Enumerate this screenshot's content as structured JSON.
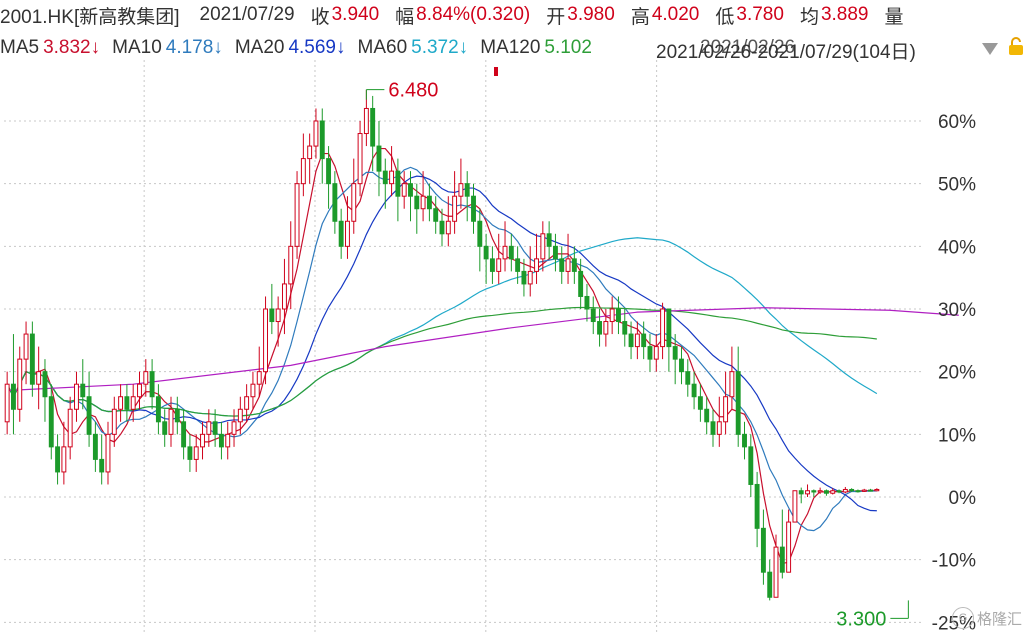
{
  "header": {
    "stock_code": "2001.HK[新高教集团]",
    "date": "2021/07/29",
    "close_label": "收",
    "close": "3.940",
    "change_label": "幅",
    "change": "8.84%(0.320)",
    "open_label": "开",
    "open": "3.980",
    "high_label": "高",
    "high": "4.020",
    "low_label": "低",
    "low": "3.780",
    "avg_label": "均",
    "avg": "3.889",
    "volume_label": "量"
  },
  "ma_row": {
    "ma5_label": "MA5",
    "ma5": "3.832↓",
    "ma10_label": "MA10",
    "ma10": "4.178↓",
    "ma20_label": "MA20",
    "ma20": "4.569↓",
    "ma60_label": "MA60",
    "ma60": "5.372↓",
    "ma120_label": "MA120",
    "ma120": "5.102",
    "overlap_text": "2021/02/26-2021/07/29(104日)",
    "overlap_date": "2021/02/26"
  },
  "toolbar": {
    "dropdown_icon": "triangle-down-icon",
    "lock_icon": "lock-icon"
  },
  "watermark": {
    "text": "格隆汇",
    "logo": "G"
  },
  "colors": {
    "up": "#d0021b",
    "down": "#1c9a2a",
    "ma5": "#c8102e",
    "ma10": "#2f7bbd",
    "ma20": "#1739c4",
    "ma60": "#1fa9c9",
    "ma120": "#2e9e38",
    "ma250": "#b01fc2",
    "grid": "#c8c8c8"
  },
  "chart_data": {
    "type": "candlestick",
    "y_axis": {
      "unit": "percent change from start",
      "min": -25,
      "max": 65,
      "ticks": [
        60,
        50,
        40,
        30,
        20,
        10,
        0,
        -10,
        -20
      ],
      "tick_labels": [
        "60%",
        "50%",
        "40%",
        "30%",
        "20%",
        "10%",
        "0%",
        "-10%",
        "-25%"
      ]
    },
    "annotations": [
      {
        "label": "6.480",
        "type": "max",
        "bar_index": 57,
        "value": 65.0
      },
      {
        "label": "3.300",
        "type": "min",
        "bar_index": 143,
        "value": -16.5
      }
    ],
    "candles": [
      [
        12,
        18,
        20,
        10
      ],
      [
        18,
        14,
        26,
        10
      ],
      [
        14,
        22,
        24,
        12
      ],
      [
        22,
        26,
        28,
        18
      ],
      [
        26,
        18,
        28,
        16
      ],
      [
        18,
        20,
        24,
        14
      ],
      [
        20,
        16,
        22,
        12
      ],
      [
        16,
        8,
        18,
        6
      ],
      [
        8,
        4,
        10,
        2
      ],
      [
        4,
        8,
        12,
        2
      ],
      [
        8,
        14,
        16,
        6
      ],
      [
        14,
        18,
        20,
        12
      ],
      [
        18,
        16,
        22,
        14
      ],
      [
        16,
        10,
        20,
        8
      ],
      [
        10,
        6,
        12,
        4
      ],
      [
        6,
        4,
        10,
        2
      ],
      [
        4,
        10,
        12,
        2
      ],
      [
        10,
        14,
        16,
        8
      ],
      [
        14,
        16,
        18,
        12
      ],
      [
        16,
        14,
        18,
        12
      ],
      [
        14,
        16,
        18,
        12
      ],
      [
        16,
        18,
        20,
        14
      ],
      [
        18,
        20,
        22,
        16
      ],
      [
        20,
        16,
        22,
        14
      ],
      [
        16,
        12,
        18,
        10
      ],
      [
        12,
        10,
        14,
        8
      ],
      [
        10,
        14,
        16,
        8
      ],
      [
        14,
        12,
        16,
        10
      ],
      [
        12,
        8,
        14,
        6
      ],
      [
        8,
        6,
        10,
        4
      ],
      [
        6,
        8,
        10,
        4
      ],
      [
        8,
        10,
        12,
        6
      ],
      [
        10,
        12,
        14,
        8
      ],
      [
        12,
        10,
        14,
        8
      ],
      [
        10,
        8,
        12,
        6
      ],
      [
        8,
        10,
        12,
        6
      ],
      [
        10,
        12,
        14,
        8
      ],
      [
        12,
        14,
        16,
        10
      ],
      [
        14,
        16,
        18,
        12
      ],
      [
        16,
        18,
        20,
        14
      ],
      [
        18,
        20,
        24,
        16
      ],
      [
        20,
        30,
        32,
        18
      ],
      [
        30,
        28,
        34,
        26
      ],
      [
        28,
        30,
        32,
        24
      ],
      [
        30,
        34,
        38,
        26
      ],
      [
        34,
        40,
        44,
        30
      ],
      [
        40,
        50,
        52,
        38
      ],
      [
        50,
        54,
        58,
        48
      ],
      [
        54,
        56,
        58,
        50
      ],
      [
        56,
        60,
        62,
        54
      ],
      [
        60,
        54,
        62,
        50
      ],
      [
        54,
        50,
        56,
        46
      ],
      [
        50,
        44,
        52,
        42
      ],
      [
        44,
        40,
        46,
        38
      ],
      [
        40,
        44,
        48,
        38
      ],
      [
        44,
        50,
        54,
        42
      ],
      [
        50,
        58,
        60,
        48
      ],
      [
        58,
        62,
        65,
        56
      ],
      [
        62,
        56,
        64,
        52
      ],
      [
        56,
        52,
        60,
        48
      ],
      [
        52,
        50,
        54,
        46
      ],
      [
        50,
        52,
        56,
        48
      ],
      [
        52,
        48,
        54,
        44
      ],
      [
        48,
        50,
        52,
        46
      ],
      [
        50,
        48,
        52,
        44
      ],
      [
        48,
        46,
        50,
        42
      ],
      [
        46,
        48,
        52,
        44
      ],
      [
        48,
        46,
        50,
        44
      ],
      [
        46,
        44,
        48,
        42
      ],
      [
        44,
        42,
        46,
        40
      ],
      [
        42,
        44,
        48,
        40
      ],
      [
        44,
        48,
        52,
        42
      ],
      [
        48,
        50,
        54,
        46
      ],
      [
        50,
        48,
        52,
        44
      ],
      [
        48,
        44,
        50,
        42
      ],
      [
        44,
        40,
        46,
        36
      ],
      [
        40,
        38,
        42,
        34
      ],
      [
        38,
        36,
        40,
        34
      ],
      [
        36,
        38,
        42,
        34
      ],
      [
        38,
        40,
        44,
        36
      ],
      [
        40,
        38,
        42,
        36
      ],
      [
        38,
        36,
        40,
        34
      ],
      [
        36,
        34,
        38,
        32
      ],
      [
        34,
        36,
        40,
        32
      ],
      [
        36,
        38,
        42,
        34
      ],
      [
        38,
        42,
        44,
        36
      ],
      [
        42,
        40,
        44,
        38
      ],
      [
        40,
        38,
        42,
        36
      ],
      [
        38,
        36,
        40,
        34
      ],
      [
        36,
        38,
        42,
        34
      ],
      [
        38,
        36,
        40,
        34
      ],
      [
        36,
        32,
        38,
        30
      ],
      [
        32,
        30,
        34,
        28
      ],
      [
        30,
        28,
        32,
        26
      ],
      [
        28,
        26,
        30,
        24
      ],
      [
        26,
        28,
        30,
        24
      ],
      [
        28,
        30,
        32,
        26
      ],
      [
        30,
        28,
        32,
        26
      ],
      [
        28,
        26,
        30,
        24
      ],
      [
        26,
        24,
        28,
        22
      ],
      [
        24,
        26,
        28,
        22
      ],
      [
        26,
        24,
        28,
        22
      ],
      [
        24,
        22,
        26,
        20
      ],
      [
        22,
        24,
        26,
        20
      ],
      [
        24,
        30,
        31,
        22
      ],
      [
        30,
        24,
        30,
        20
      ],
      [
        24,
        22,
        26,
        18
      ],
      [
        22,
        20,
        24,
        18
      ],
      [
        20,
        18,
        22,
        16
      ],
      [
        18,
        16,
        20,
        14
      ],
      [
        16,
        14,
        18,
        12
      ],
      [
        14,
        12,
        16,
        10
      ],
      [
        12,
        10,
        14,
        8
      ],
      [
        10,
        12,
        16,
        8
      ],
      [
        12,
        16,
        20,
        10
      ],
      [
        16,
        20,
        24,
        14
      ],
      [
        20,
        10,
        24,
        8
      ],
      [
        10,
        8,
        12,
        6
      ],
      [
        8,
        2,
        10,
        0
      ],
      [
        2,
        -5,
        4,
        -8
      ],
      [
        -5,
        -12,
        -2,
        -14
      ],
      [
        -12,
        -16,
        -10,
        -16.5
      ],
      [
        -16,
        -8,
        -6,
        -16
      ],
      [
        -8,
        -12,
        -2,
        -13
      ],
      [
        -12,
        -4,
        -2,
        -12
      ],
      [
        -4,
        1,
        1,
        -3
      ],
      [
        1,
        0.5,
        1.5,
        -1
      ],
      [
        0.5,
        1,
        2,
        0
      ],
      [
        1,
        0.8,
        1.2,
        0
      ],
      [
        0.8,
        1,
        1.5,
        0.5
      ],
      [
        1,
        0.6,
        1.2,
        0.2
      ],
      [
        0.6,
        1,
        1.4,
        0.4
      ],
      [
        1,
        0.8,
        1.2,
        0.6
      ],
      [
        0.8,
        1.2,
        1.6,
        0.6
      ],
      [
        1.2,
        1,
        1.4,
        0.8
      ],
      [
        1,
        0.9,
        1.2,
        0.7
      ],
      [
        0.9,
        1.1,
        1.3,
        0.8
      ],
      [
        1.1,
        1,
        1.3,
        0.9
      ],
      [
        1,
        1.2,
        1.4,
        0.9
      ]
    ],
    "series": [
      {
        "name": "MA5",
        "color": "#c8102e"
      },
      {
        "name": "MA10",
        "color": "#2f7bbd"
      },
      {
        "name": "MA20",
        "color": "#1739c4"
      },
      {
        "name": "MA60",
        "color": "#1fa9c9"
      },
      {
        "name": "MA120",
        "color": "#2e9e38"
      },
      {
        "color": "#b01fc2",
        "points": [
          [
            0,
            17
          ],
          [
            20,
            18
          ],
          [
            45,
            21
          ],
          [
            60,
            24
          ],
          [
            80,
            27
          ],
          [
            100,
            29.5
          ],
          [
            120,
            30.2
          ],
          [
            140,
            29.8
          ],
          [
            151,
            29
          ]
        ]
      }
    ],
    "grid": true,
    "legend": "top"
  }
}
